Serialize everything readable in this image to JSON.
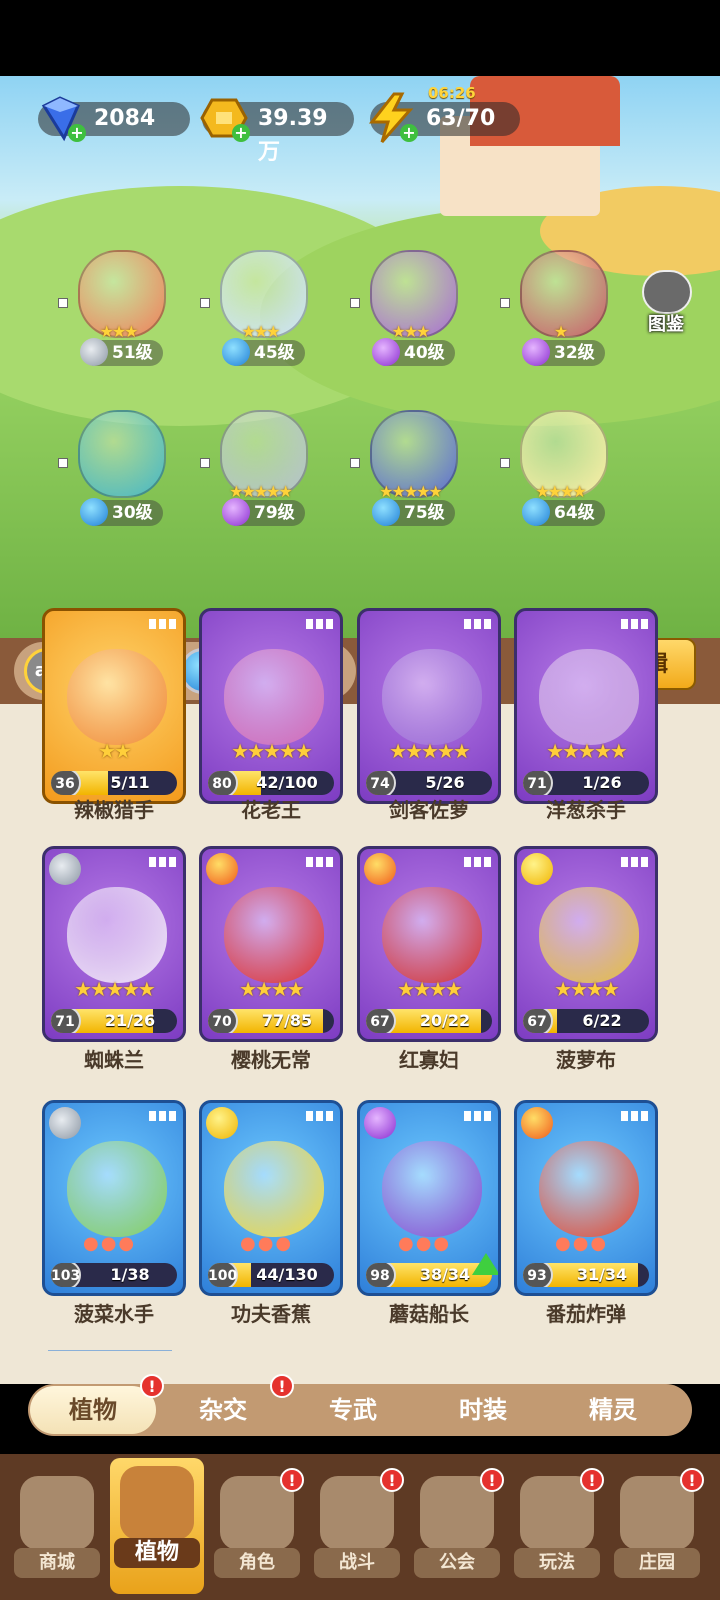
{
  "resources": {
    "gems": "2084",
    "coins": "39.39万",
    "energy": "63/70",
    "energy_timer": "06:26"
  },
  "scene": {
    "codex_label": "图鉴"
  },
  "team": [
    {
      "level": "51级",
      "element": "sword",
      "stars": 3,
      "color": "#f07e5a"
    },
    {
      "level": "45级",
      "element": "water",
      "stars": 3,
      "color": "#cfe3ff"
    },
    {
      "level": "40级",
      "element": "potion",
      "stars": 3,
      "color": "#a86ad6"
    },
    {
      "level": "32级",
      "element": "potion",
      "stars": 1,
      "color": "#c85a6a"
    },
    {
      "level": "30级",
      "element": "water",
      "stars": 0,
      "color": "#46b7c8"
    },
    {
      "level": "79级",
      "element": "potion",
      "stars": 5,
      "color": "#b6c2d0"
    },
    {
      "level": "75级",
      "element": "water",
      "stars": 5,
      "color": "#5a6ad6"
    },
    {
      "level": "64级",
      "element": "water",
      "stars": 4,
      "color": "#fff0a8"
    }
  ],
  "filters": [
    {
      "id": "all",
      "label": "all"
    },
    {
      "id": "sword",
      "label": ""
    },
    {
      "id": "potion",
      "label": ""
    },
    {
      "id": "water",
      "label": ""
    },
    {
      "id": "fire",
      "label": ""
    },
    {
      "id": "bolt",
      "label": ""
    }
  ],
  "team_edit_label": "队伍编辑",
  "cards": [
    {
      "name": "辣椒猎手",
      "level": "36",
      "count": "5/11",
      "progress": 0.45,
      "rarity": "orange",
      "element": "",
      "stars": 2,
      "char_color": "#f08a3a"
    },
    {
      "name": "花老王",
      "level": "80",
      "count": "42/100",
      "progress": 0.42,
      "rarity": "purple",
      "element": "",
      "stars": 5,
      "char_color": "#d36ab5"
    },
    {
      "name": "剑客佐萝",
      "level": "74",
      "count": "5/26",
      "progress": 0.19,
      "rarity": "purple",
      "element": "",
      "stars": 5,
      "char_color": "#9a6ad6"
    },
    {
      "name": "洋葱杀手",
      "level": "71",
      "count": "1/26",
      "progress": 0.04,
      "rarity": "purple",
      "element": "",
      "stars": 5,
      "char_color": "#c8a0e0"
    },
    {
      "name": "蜘蛛兰",
      "level": "71",
      "count": "21/26",
      "progress": 0.81,
      "rarity": "purple",
      "element": "sword",
      "stars": 5,
      "char_color": "#f2e8f8"
    },
    {
      "name": "樱桃无常",
      "level": "70",
      "count": "77/85",
      "progress": 0.91,
      "rarity": "purple",
      "element": "fire",
      "stars": 4,
      "char_color": "#e0302a"
    },
    {
      "name": "红寡妇",
      "level": "67",
      "count": "20/22",
      "progress": 0.91,
      "rarity": "purple",
      "element": "fire",
      "stars": 4,
      "char_color": "#d6302a"
    },
    {
      "name": "菠萝布",
      "level": "67",
      "count": "6/22",
      "progress": 0.27,
      "rarity": "purple",
      "element": "bolt",
      "stars": 4,
      "char_color": "#e8c23a"
    },
    {
      "name": "菠菜水手",
      "level": "103",
      "count": "1/38",
      "progress": 0.03,
      "rarity": "blue",
      "element": "sword",
      "stars": 0,
      "char_color": "#86d25a"
    },
    {
      "name": "功夫香蕉",
      "level": "100",
      "count": "44/130",
      "progress": 0.34,
      "rarity": "blue",
      "element": "bolt",
      "stars": 0,
      "char_color": "#f5dc3a"
    },
    {
      "name": "蘑菇船长",
      "level": "98",
      "count": "38/34",
      "progress": 1.0,
      "rarity": "blue",
      "element": "potion",
      "stars": 0,
      "char_color": "#8a4ad0"
    },
    {
      "name": "番茄炸弹",
      "level": "93",
      "count": "31/34",
      "progress": 0.91,
      "rarity": "blue",
      "element": "fire",
      "stars": 0,
      "char_color": "#e8462a"
    }
  ],
  "tabs": [
    {
      "label": "植物",
      "active": true,
      "badge": "!"
    },
    {
      "label": "杂交",
      "active": false,
      "badge": "!"
    },
    {
      "label": "专武",
      "active": false,
      "badge": ""
    },
    {
      "label": "时装",
      "active": false,
      "badge": ""
    },
    {
      "label": "精灵",
      "active": false,
      "badge": ""
    }
  ],
  "nav": [
    {
      "label": "商城",
      "active": false,
      "badge": ""
    },
    {
      "label": "植物",
      "active": true,
      "badge": ""
    },
    {
      "label": "角色",
      "active": false,
      "badge": "!"
    },
    {
      "label": "战斗",
      "active": false,
      "badge": "!"
    },
    {
      "label": "公会",
      "active": false,
      "badge": "!"
    },
    {
      "label": "玩法",
      "active": false,
      "badge": "!"
    },
    {
      "label": "庄园",
      "active": false,
      "badge": "!"
    }
  ]
}
